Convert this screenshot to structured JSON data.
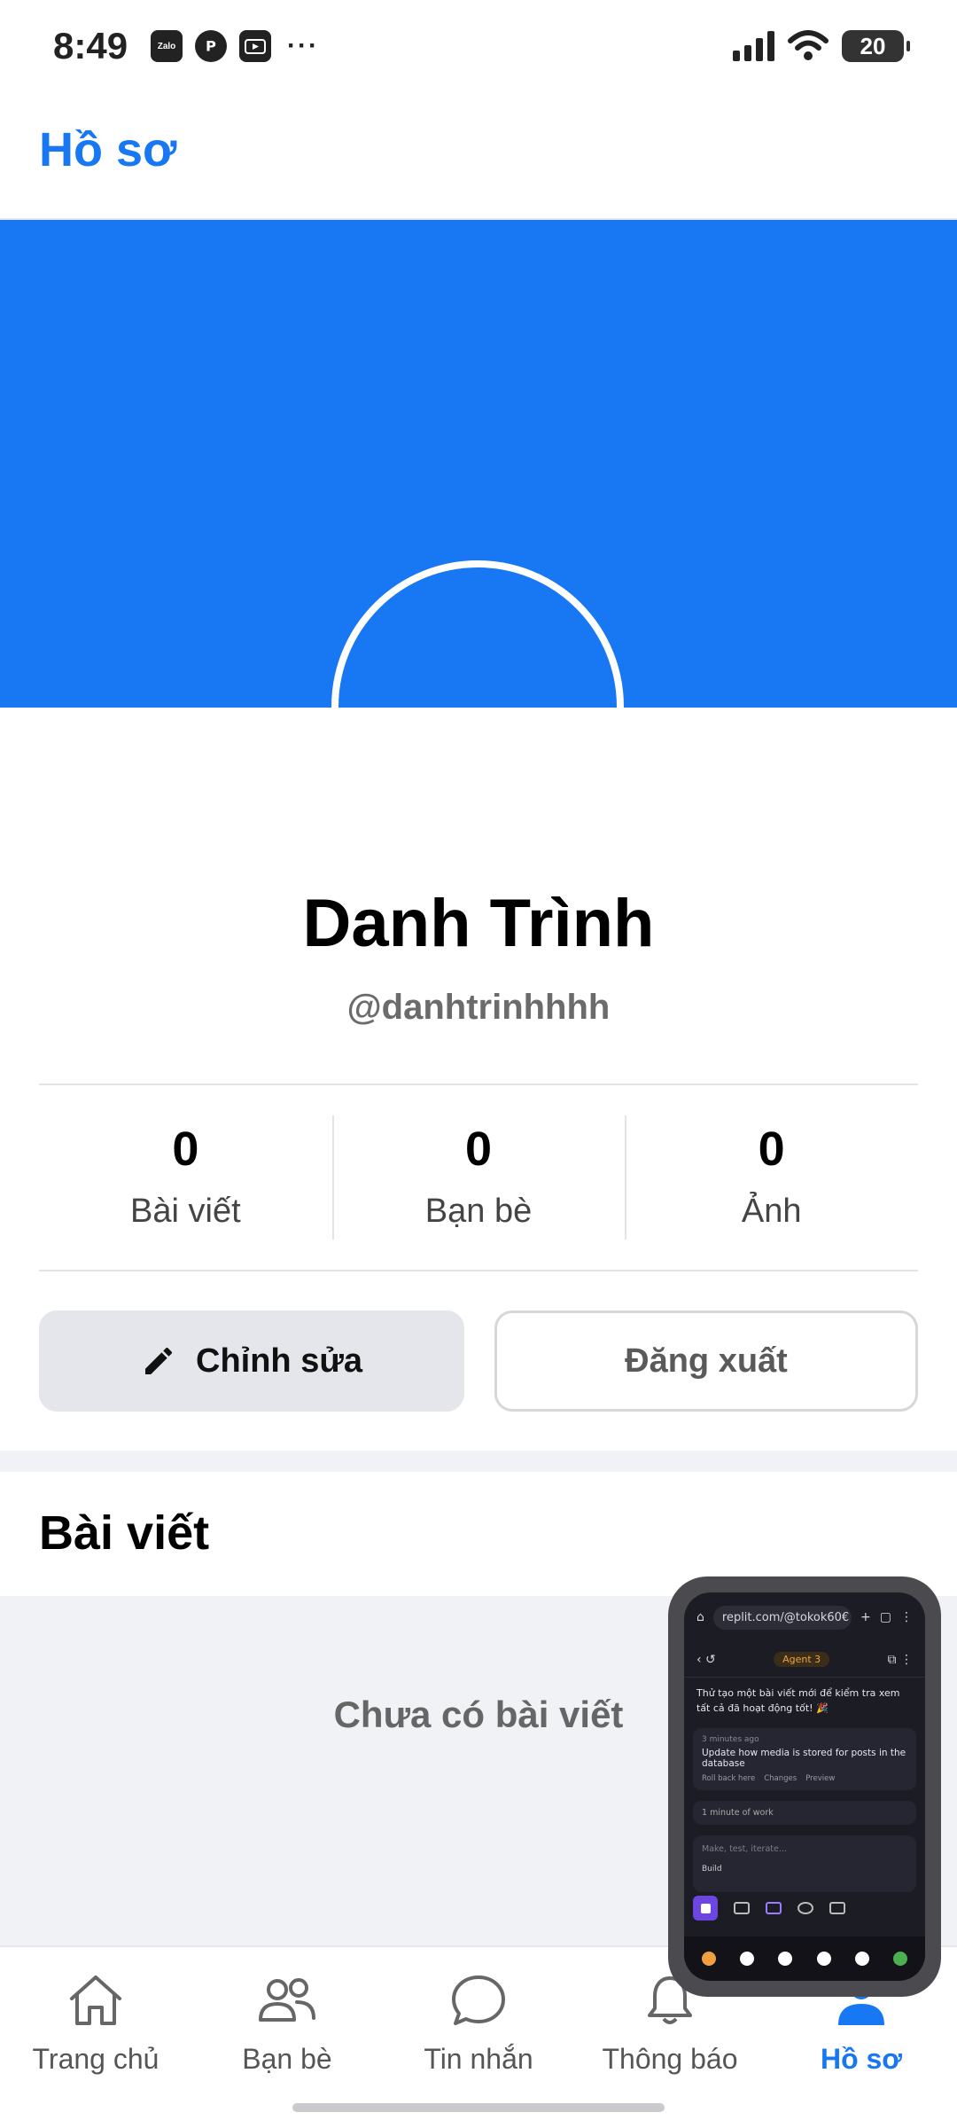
{
  "status_bar": {
    "time": "8:49",
    "apps": [
      "Zalo",
      "Pinterest",
      "Slideshow"
    ],
    "dots": "···",
    "battery": "20"
  },
  "header": {
    "title": "Hồ sơ"
  },
  "colors": {
    "brand": "#1877f2",
    "cover": "#1877f2",
    "muted_bg": "#f0f2f5"
  },
  "profile": {
    "name": "Danh Trình",
    "handle": "@danhtrinhhhh"
  },
  "stats": [
    {
      "value": "0",
      "label": "Bài viết"
    },
    {
      "value": "0",
      "label": "Bạn bè"
    },
    {
      "value": "0",
      "label": "Ảnh"
    }
  ],
  "actions": {
    "edit_label": "Chỉnh sửa",
    "logout_label": "Đăng xuất"
  },
  "posts": {
    "section_title": "Bài viết",
    "empty_text": "Chưa có bài viết"
  },
  "bottom_nav": [
    {
      "label": "Trang chủ",
      "icon": "home-icon",
      "active": false
    },
    {
      "label": "Bạn bè",
      "icon": "friends-icon",
      "active": false
    },
    {
      "label": "Tin nhắn",
      "icon": "chat-icon",
      "active": false
    },
    {
      "label": "Thông báo",
      "icon": "bell-icon",
      "active": false
    },
    {
      "label": "Hồ sơ",
      "icon": "profile-icon",
      "active": true
    }
  ],
  "pip": {
    "url": "replit.com/@tokok60€",
    "agent_label": "Agent 3",
    "message": "Thử tạo một bài viết mới để kiểm tra xem tất cả đã hoạt động tốt! 🎉",
    "card_time": "3 minutes ago",
    "card_title": "Update how media is stored for posts in the database",
    "chips": [
      "Roll back here",
      "Changes",
      "Preview"
    ],
    "work": "1 minute of work",
    "input_placeholder": "Make, test, iterate...",
    "build_label": "Build"
  }
}
